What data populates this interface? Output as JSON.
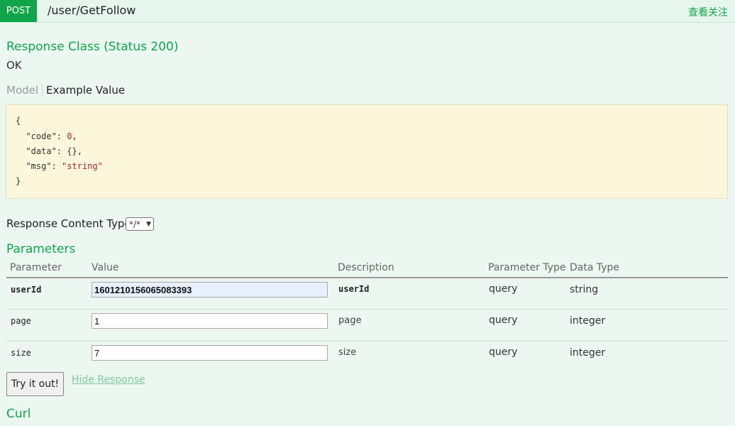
{
  "header": {
    "method": "POST",
    "path": "/user/GetFollow",
    "summary": "查看关注"
  },
  "response_class": {
    "title": "Response Class (Status 200)",
    "status_text": "OK"
  },
  "tabs": {
    "model": "Model",
    "example": "Example Value"
  },
  "example_lines": [
    "{",
    "  \"code\": ",
    "0",
    ",",
    "  \"data\": {},",
    "  \"msg\": ",
    "\"string\"",
    "}"
  ],
  "response_content_type": {
    "label": "Response Content Type",
    "selected": "*/*"
  },
  "parameters": {
    "title": "Parameters",
    "headers": [
      "Parameter",
      "Value",
      "Description",
      "Parameter Type",
      "Data Type"
    ],
    "rows": [
      {
        "name": "userId",
        "value": "1601210156065083393",
        "description": "userId",
        "param_type": "query",
        "data_type": "string"
      },
      {
        "name": "page",
        "value": "1",
        "description": "page",
        "param_type": "query",
        "data_type": "integer"
      },
      {
        "name": "size",
        "value": "7",
        "description": "size",
        "param_type": "query",
        "data_type": "integer"
      }
    ]
  },
  "actions": {
    "try": "Try it out!",
    "hide": "Hide Response"
  },
  "curl_title": "Curl",
  "colors": {
    "accent": "#10a54a",
    "background": "#ebf7f0",
    "code_bg": "#fcf6db"
  }
}
